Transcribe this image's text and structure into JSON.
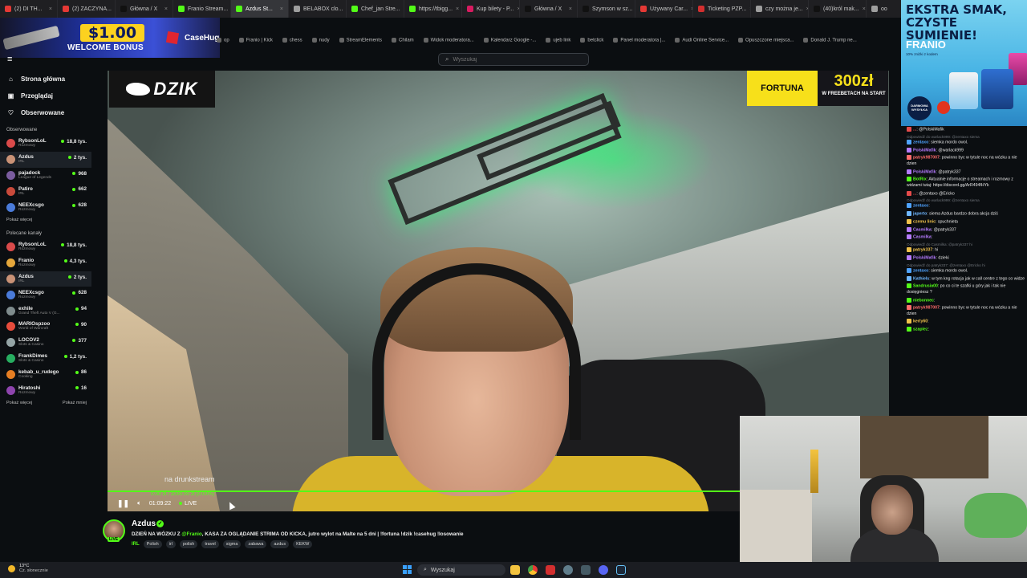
{
  "browser": {
    "tabs": [
      {
        "label": "(2) DI TH...",
        "color": "#e53935"
      },
      {
        "label": "(2) ZACZYNA...",
        "color": "#e53935"
      },
      {
        "label": "Główna / X",
        "color": "#111111"
      },
      {
        "label": "Franio Stream...",
        "color": "#53fc18"
      },
      {
        "label": "Azdus St...",
        "color": "#53fc18",
        "active": true
      },
      {
        "label": "BELABOX clo...",
        "color": "#9e9e9e"
      },
      {
        "label": "Chef_jan Stre...",
        "color": "#53fc18"
      },
      {
        "label": "https://tbigg...",
        "color": "#53fc18"
      },
      {
        "label": "Kup bilety - P...",
        "color": "#d81b60"
      },
      {
        "label": "Główna / X",
        "color": "#111111"
      },
      {
        "label": "Szymson w sz...",
        "color": "#111111"
      },
      {
        "label": "Używany Car...",
        "color": "#e53935"
      },
      {
        "label": "Ticketing PZP...",
        "color": "#d32f2f"
      },
      {
        "label": "czy można je...",
        "color": "#9e9e9e"
      },
      {
        "label": "(40)król mak...",
        "color": "#111111"
      },
      {
        "label": "oo",
        "color": "#9e9e9e"
      }
    ],
    "bookmarks": [
      "op",
      "Franio | Kick",
      "chess",
      "nudy",
      "StreamElements",
      "Chilam",
      "Widok moderatora...",
      "Kalendarz Google -...",
      "ujeb link",
      "betclick",
      "Panel moderatora |...",
      "Audi Online Service...",
      "Opuszczone miejsca...",
      "Donald J. Trump ne..."
    ]
  },
  "search": {
    "placeholder": "Wyszukaj"
  },
  "ads": {
    "casehug": {
      "price": "$1.00",
      "promo": "WELCOME BONUS",
      "brand": "CaseHug"
    },
    "fortuna": {
      "brand": "FORTUNA",
      "amount": "300zł",
      "sub": "W FREEBETACH NA START"
    },
    "franio": {
      "headline_1": "EKSTRA SMAK,",
      "headline_2": "CZYSTE SUMIENIE!",
      "brand": "FRANIO",
      "tagline": "10% zniżki z kodem",
      "badge": "DARMOWA WYSYŁKA"
    }
  },
  "sidebar": {
    "nav": [
      {
        "label": "Strona główna",
        "icon": "home-icon",
        "glyph": "⌂"
      },
      {
        "label": "Przeglądaj",
        "icon": "browse-icon",
        "glyph": "▣"
      },
      {
        "label": "Obserwowane",
        "icon": "heart-icon",
        "glyph": "♡"
      }
    ],
    "followed_header": "Obserwowane",
    "followed": [
      {
        "name": "RybsonLoL",
        "category": "Rozmowy",
        "viewers": "18,8 tys.",
        "color": "#d94a4a"
      },
      {
        "name": "Azdus",
        "category": "IRL",
        "viewers": "2 tys.",
        "color": "#c99276",
        "selected": true
      },
      {
        "name": "pajadock",
        "category": "League of Legends",
        "viewers": "968",
        "color": "#7a5c9e"
      },
      {
        "name": "Patiro",
        "category": "IRL",
        "viewers": "662",
        "color": "#c94a3b"
      },
      {
        "name": "NEEXcsgo",
        "category": "Rozmowy",
        "viewers": "628",
        "color": "#4a7bd9"
      }
    ],
    "show_more": "Pokaż więcej",
    "recommended_header": "Polecane kanały",
    "recommended": [
      {
        "name": "RybsonLoL",
        "category": "Rozmowy",
        "viewers": "18,8 tys.",
        "color": "#d94a4a"
      },
      {
        "name": "Franio",
        "category": "Rozmowy",
        "viewers": "4,3 tys.",
        "color": "#e5a73b"
      },
      {
        "name": "Azdus",
        "category": "IRL",
        "viewers": "2 tys.",
        "color": "#c99276",
        "selected": true
      },
      {
        "name": "NEEXcsgo",
        "category": "Rozmowy",
        "viewers": "628",
        "color": "#4a7bd9"
      },
      {
        "name": "exhile",
        "category": "Grand Theft Auto V (G...",
        "viewers": "94",
        "color": "#7f8c8d"
      },
      {
        "name": "MARIOspzoo",
        "category": "World of Warcraft",
        "viewers": "90",
        "color": "#e74c3c"
      },
      {
        "name": "LOCOV2",
        "category": "Slots & Casino",
        "viewers": "377",
        "color": "#95a5a6"
      },
      {
        "name": "FrankDimes",
        "category": "Slots & Casino",
        "viewers": "1,2 tys.",
        "color": "#27ae60"
      },
      {
        "name": "kebab_u_rudego",
        "category": "Cooking",
        "viewers": "86",
        "color": "#e67e22"
      },
      {
        "name": "Hiratoshi",
        "category": "Rozmowy",
        "viewers": "16",
        "color": "#8e44ad"
      }
    ],
    "show_more_2": "Pokaż więcej",
    "show_less": "Pokaż mniej"
  },
  "player": {
    "logo": "DZIK",
    "overlay_name": "na drunkstream",
    "goal_text": "0.00 zł / 1000.00 zł (0.00%)",
    "time": "01:09:22",
    "live_label": "LIVE"
  },
  "stream": {
    "live_badge": "LIVE",
    "streamer": "Azdus",
    "title_before": "DZIEŃ NA WÓZKU Z ",
    "title_mention": "@Franio",
    "title_after": ", KASA ZA OGLĄDANIE STRIMA OD KICKA, jutro wylot na Malte na 5  dni | !fortuna !dzik !casehug !losowanie",
    "category": "IRL",
    "tags": [
      "Polish",
      "irl",
      "polish",
      "travel",
      "sigma",
      "zabawa",
      "azdus",
      "KEKW"
    ]
  },
  "chat": [
    {
      "reply": "",
      "user": "...",
      "text": ": @PolskiMafik",
      "color": "#e54b4b"
    },
    {
      "reply": "Odpowiedź do warlack999: @zentaxo siema",
      "user": "zentaxo",
      "text": ": siemka mordo owol.",
      "color": "#4fa3ff"
    },
    {
      "reply": "",
      "user": "PolskiMafik",
      "text": ": @warlack999",
      "color": "#b57bff"
    },
    {
      "reply": "",
      "user": "patryk987007",
      "text": ": powinno byc w tytule noc na wózku a nie dzien",
      "color": "#ff6b6b"
    },
    {
      "reply": "",
      "user": "PolskiMafik",
      "text": ": @patryk337",
      "color": "#b57bff"
    },
    {
      "reply": "",
      "user": "BotRix",
      "text": ": Aktualnie informacje o streamach i rozmowy z widzami tutaj: https://discord.gg/ArR494fHYk",
      "color": "#53fc18"
    },
    {
      "reply": "",
      "user": "...",
      "text": ": @zentaxo @Ericko",
      "color": "#e54b4b"
    },
    {
      "reply": "Odpowiedź do warlack999: @zentaxo siema",
      "user": "zentaxo",
      "text": ":",
      "color": "#4fa3ff"
    },
    {
      "reply": "",
      "user": "japerto",
      "text": ": siema Azdus bardzo dobra akcja dziś",
      "color": "#6fb7ff"
    },
    {
      "reply": "",
      "user": "czemu linic",
      "text": ": spuchnieta",
      "color": "#f0c24b"
    },
    {
      "reply": "",
      "user": "Casmilka",
      "text": ": @patryk337",
      "color": "#b57bff"
    },
    {
      "reply": "",
      "user": "Casmilka",
      "text": ":",
      "color": "#b57bff"
    },
    {
      "reply": "Odpowiedź do Casmilka: @patryk337 hi",
      "user": "patryk337",
      "text": ": hi",
      "color": "#f0c24b"
    },
    {
      "reply": "",
      "user": "PolskiMafik",
      "text": ": dzieki",
      "color": "#b57bff"
    },
    {
      "reply": "Odpowiedź do patryk337: @zentaxo @Ericko hi",
      "user": "zentaxo",
      "text": ": siemka mordo owol.",
      "color": "#4fa3ff"
    },
    {
      "reply": "",
      "user": "Kathiels",
      "text": ": w tym kng rotacja jak w call centre z tego co widze",
      "color": "#6fb7ff"
    },
    {
      "reply": "",
      "user": "Sandrusia00",
      "text": ": po co ci te szafki u góry jak i tak nie dosięgniesz ?",
      "color": "#53fc18"
    },
    {
      "reply": "",
      "user": "niebonnec",
      "text": ":",
      "color": "#53fc18"
    },
    {
      "reply": "",
      "user": "patryk987007",
      "text": ": powinno byc w tytule noc na wózku a nie dzien",
      "color": "#ff6b6b"
    },
    {
      "reply": "",
      "user": "kerty60",
      "text": ":",
      "color": "#f0c24b"
    },
    {
      "reply": "",
      "user": "szaplez",
      "text": ":",
      "color": "#53fc18"
    }
  ],
  "taskbar": {
    "temperature": "13°C",
    "weather": "Cz. słonecznie",
    "search_label": "Wyszukaj"
  }
}
